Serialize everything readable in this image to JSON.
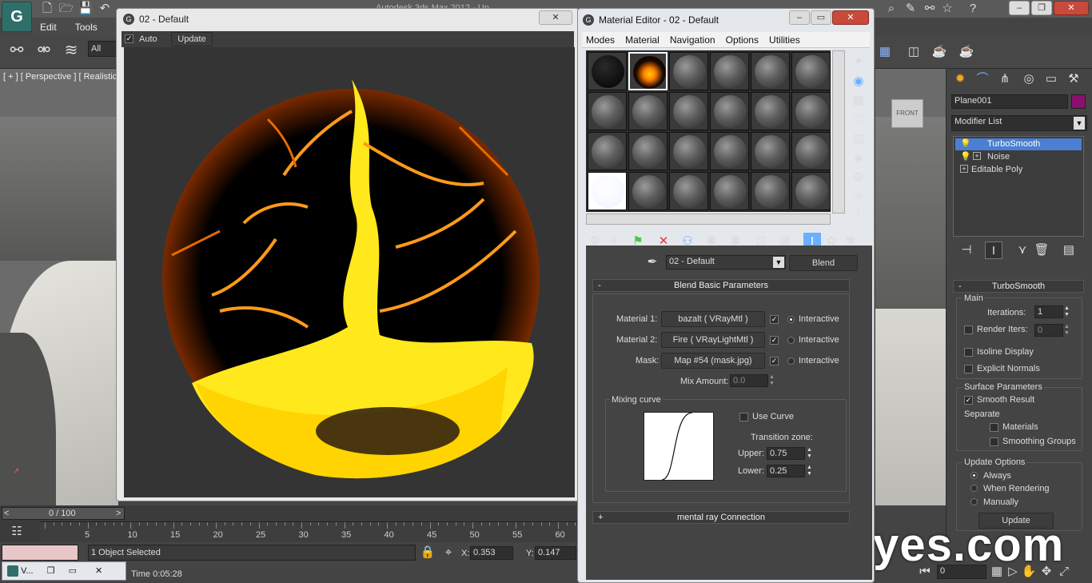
{
  "app": {
    "menu": [
      "Edit",
      "Tools"
    ],
    "title_partial": "Autodesk 3ds Max 2012 - Un...",
    "selection_filter": "All",
    "viewport_label": "[ + ] [ Perspective ] [ Realistic"
  },
  "render_window": {
    "title": "02 - Default",
    "auto_label": "Auto",
    "auto_checked": true,
    "update_label": "Update"
  },
  "material_editor": {
    "title": "Material Editor - 02 - Default",
    "menu": [
      "Modes",
      "Material",
      "Navigation",
      "Options",
      "Utilities"
    ],
    "material_name": "02 - Default",
    "material_type": "Blend",
    "rollout_title": "Blend Basic Parameters",
    "rollout_collapse": "-",
    "material1_label": "Material 1:",
    "material1_value": "bazalt  ( VRayMtl )",
    "material2_label": "Material 2:",
    "material2_value": "Fire  ( VRayLightMtl )",
    "mask_label": "Mask:",
    "mask_value": "Map #54 (mask.jpg)",
    "interactive_label": "Interactive",
    "mix_amount_label": "Mix Amount:",
    "mix_amount_value": "0.0",
    "mixing_curve_label": "Mixing curve",
    "use_curve_label": "Use Curve",
    "transition_zone_label": "Transition zone:",
    "upper_label": "Upper:",
    "upper_value": "0.75",
    "lower_label": "Lower:",
    "lower_value": "0.25",
    "mental_ray_rollout": "mental ray Connection",
    "mental_ray_expand": "+"
  },
  "command_panel": {
    "object_name": "Plane001",
    "object_color": "#8a0f6e",
    "modifier_list_label": "Modifier List",
    "stack": [
      "TurboSmooth",
      "Noise",
      "Editable Poly"
    ],
    "turbosmooth_title": "TurboSmooth",
    "main_label": "Main",
    "iterations_label": "Iterations:",
    "iterations_value": "1",
    "render_iters_label": "Render Iters:",
    "render_iters_value": "0",
    "isoline_label": "Isoline Display",
    "explicit_normals_label": "Explicit Normals",
    "surface_params_label": "Surface Parameters",
    "smooth_result_label": "Smooth Result",
    "separate_label": "Separate",
    "materials_label": "Materials",
    "smoothing_groups_label": "Smoothing Groups",
    "update_options_label": "Update Options",
    "always_label": "Always",
    "when_rendering_label": "When Rendering",
    "manually_label": "Manually",
    "update_button": "Update"
  },
  "timeline": {
    "frame_counter": "0 / 100",
    "ticks": [
      "5",
      "10",
      "15",
      "20",
      "25",
      "30",
      "35",
      "40",
      "45",
      "50",
      "55",
      "60"
    ]
  },
  "status": {
    "selection": "1 Object Selected",
    "x_label": "X:",
    "x_value": "0.353",
    "y_label": "Y:",
    "y_value": "0.147",
    "time_label": "Time  0:05:28",
    "frame_field": "0",
    "taskbar_item": "V..."
  },
  "watermark": "pxleyes.com"
}
